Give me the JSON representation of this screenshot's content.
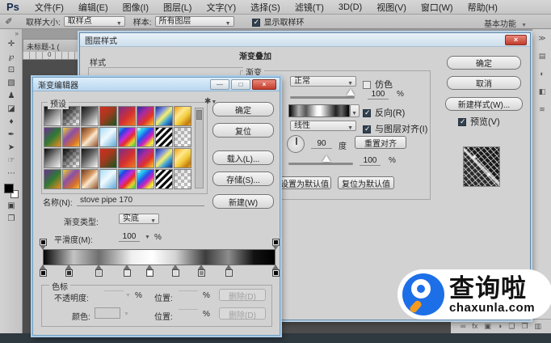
{
  "menu_bar": {
    "logo": "Ps",
    "items": [
      {
        "name": "file",
        "label": "文件(F)"
      },
      {
        "name": "edit",
        "label": "编辑(E)"
      },
      {
        "name": "image",
        "label": "图像(I)"
      },
      {
        "name": "layer",
        "label": "图层(L)"
      },
      {
        "name": "type",
        "label": "文字(Y)"
      },
      {
        "name": "select",
        "label": "选择(S)"
      },
      {
        "name": "filter",
        "label": "滤镜(T)"
      },
      {
        "name": "3d",
        "label": "3D(D)"
      },
      {
        "name": "view",
        "label": "视图(V)"
      },
      {
        "name": "window",
        "label": "窗口(W)"
      },
      {
        "name": "help",
        "label": "帮助(H)"
      }
    ]
  },
  "options_bar": {
    "tool_glyph": "✐",
    "sample_size_label": "取样大小:",
    "sample_size_value": "取样点",
    "sample_label": "样本:",
    "sample_value": "所有图层",
    "show_ring_label": "显示取样环",
    "workspace": "基本功能"
  },
  "document": {
    "tab": "未标题-1 (",
    "ruler_zero": "0"
  },
  "toolbar": {
    "collapse_glyph": "»",
    "tools": [
      {
        "name": "move-tool",
        "glyph": "✛"
      },
      {
        "name": "lasso-tool",
        "glyph": "℘"
      },
      {
        "name": "crop-tool",
        "glyph": "⊡"
      },
      {
        "name": "healing-brush-tool",
        "glyph": "▧"
      },
      {
        "name": "clone-stamp-tool",
        "glyph": "♟"
      },
      {
        "name": "eraser-tool",
        "glyph": "◪"
      },
      {
        "name": "blur-tool",
        "glyph": "♦"
      },
      {
        "name": "pen-tool",
        "glyph": "✒"
      },
      {
        "name": "path-selection-tool",
        "glyph": "➤"
      },
      {
        "name": "hand-tool",
        "glyph": "☞"
      },
      {
        "name": "more-tools",
        "glyph": "⋯"
      }
    ],
    "bottom_tools": [
      {
        "name": "quick-mask-icon",
        "glyph": "▣"
      },
      {
        "name": "screen-mode-icon",
        "glyph": "❐"
      }
    ]
  },
  "dock": {
    "icons": [
      {
        "name": "dock-collapse-icon",
        "glyph": "≫"
      },
      {
        "name": "dock-panel-icon-1",
        "glyph": "▤"
      },
      {
        "name": "dock-panel-icon-2",
        "glyph": "◐"
      },
      {
        "name": "dock-panel-icon-3",
        "glyph": "◧"
      },
      {
        "name": "dock-panel-icon-4",
        "glyph": "≋"
      }
    ]
  },
  "layers_panel": {
    "icons": [
      {
        "name": "link-layers-icon",
        "glyph": "∞"
      },
      {
        "name": "layer-effects-icon",
        "glyph": "fx"
      },
      {
        "name": "layer-mask-icon",
        "glyph": "▣"
      },
      {
        "name": "adjustment-layer-icon",
        "glyph": "◑"
      },
      {
        "name": "layer-group-icon",
        "glyph": "❏"
      },
      {
        "name": "new-layer-icon",
        "glyph": "❐"
      },
      {
        "name": "delete-layer-icon",
        "glyph": "▥"
      }
    ]
  },
  "layer_style_dialog": {
    "title": "图层样式",
    "close_glyph": "×",
    "styles_label": "样式",
    "section_title": "渐变叠加",
    "group_label": "渐变",
    "blend_mode_value": "正常",
    "dither_label": "仿色",
    "opacity_value": "100",
    "percent": "%",
    "reverse_label": "反向(R)",
    "style_value": "线性",
    "align_label": "与图层对齐(I)",
    "angle_value": "90",
    "degree_label": "度",
    "reset_align_label": "重置对齐",
    "scale_value": "100",
    "set_default_label": "设置为默认值",
    "reset_default_label": "复位为默认值",
    "ok_label": "确定",
    "cancel_label": "取消",
    "new_style_label": "新建样式(W)...",
    "preview_label": "预览(V)",
    "gradient_css": "linear-gradient(90deg,#000 0%,#b0b0b0 16%,#555 28%,#f8f8f8 46%,#fff 52%,#999 64%,#222 78%,#666 87%,#000 100%)"
  },
  "gradient_editor": {
    "title": "渐变编辑器",
    "window_buttons": [
      {
        "name": "minimize-button",
        "glyph": "—"
      },
      {
        "name": "maximize-button",
        "glyph": "□"
      },
      {
        "name": "close-button",
        "glyph": "×",
        "red": true
      }
    ],
    "presets_label": "预设",
    "gear_glyph": "✱",
    "ok_label": "确定",
    "reset_label": "复位",
    "load_label": "载入(L)...",
    "save_label": "存储(S)...",
    "new_label": "新建(W)",
    "name_label": "名称(N):",
    "name_value": "stove pipe 170",
    "type_label": "渐变类型:",
    "type_value": "实底",
    "smoothness_label": "平滑度(M):",
    "smoothness_value": "100",
    "percent": "%",
    "stops_label": "色标",
    "opacity_label": "不透明度:",
    "location_label": "位置:",
    "delete_label": "删除(D)",
    "color_label": "颜色:",
    "preset_rows_repeat": 2,
    "presets": [
      {
        "name": "foreground-to-background",
        "css": "linear-gradient(135deg,#050505 0%,#9a9a9a 55%,#f5f5f5 100%)"
      },
      {
        "name": "foreground-to-transparent",
        "css": "linear-gradient(135deg,#050505 0%,rgba(5,5,5,0) 95%)"
      },
      {
        "name": "black-white",
        "css": "linear-gradient(135deg,#161616 0%,#5e5e5e 40%,#fdfdfd 100%)"
      },
      {
        "name": "red-green",
        "css": "linear-gradient(135deg,#d62c22 0%,#a03a1e 45%,#14571f 100%)"
      },
      {
        "name": "violet-red-orange",
        "css": "linear-gradient(135deg,#7a2d8f 0%,#d6302f 55%,#ef7d1d 100%)"
      },
      {
        "name": "blue-red-yellow",
        "css": "linear-gradient(135deg,#2a2ea8 0%,#a82ba0 35%,#e03326 65%,#f2d22e 100%)"
      },
      {
        "name": "blue-yellow-blue",
        "css": "linear-gradient(135deg,#1d2f8f 0%,#7a8fe0 28%,#f6ef70 50%,#38a0d8 72%,#16267a 100%)"
      },
      {
        "name": "gold",
        "css": "linear-gradient(135deg,#f2990f 0%,#ffe98c 35%,#f2c93a 60%,#c27a0c 85%,#f2a818 100%)"
      },
      {
        "name": "violet-green-orange",
        "css": "linear-gradient(135deg,#6b2e8f 0%,#2e7a35 50%,#ef8c1a 100%)"
      },
      {
        "name": "yellow-violet-orange",
        "css": "linear-gradient(135deg,#f2d230 0%,#8a4fa8 40%,#d8702a 75%,#f2bd45 100%)"
      },
      {
        "name": "copper",
        "css": "linear-gradient(135deg,#6e3a1d 0%,#d89a66 40%,#fae8cf 55%,#8f4f26 100%)"
      },
      {
        "name": "pastel-blue",
        "css": "linear-gradient(135deg,#a8dcf5 0%,#f0faff 45%,#5ba6d8 100%)"
      },
      {
        "name": "spectrum",
        "css": "linear-gradient(135deg,#2bc8f0 0%,#2b3fe0 22%,#c02bd8 44%,#e82b2b 62%,#e8d02b 80%,#2bd058 100%)"
      },
      {
        "name": "rainbow-transparent",
        "css": "linear-gradient(135deg,rgba(255,255,255,0) 0%,#20c8f0 22%,#2b50e8 42%,#d020c0 62%,#f0e020 82%,rgba(255,255,255,0) 100%)"
      },
      {
        "name": "bw-stripes",
        "css": "repeating-linear-gradient(135deg,#0d0d0d 0px,#0d0d0d 3px,#f8f8f8 3px,#f8f8f8 6px)"
      },
      {
        "name": "transparent",
        "css": "linear-gradient(135deg,rgba(120,120,120,0.25) 0%,rgba(120,120,120,0) 100%)"
      }
    ],
    "bar_css": "linear-gradient(90deg,#050505 0%,#c4c4c4 13%,#6e6e6e 24%,#efefef 38%,#ffffff 47%,#d4d4d4 57%,#3d3d3d 70%,#8c8c8c 80%,#111 91%,#000 100%)",
    "opacity_stops": [
      {
        "pos": 0
      },
      {
        "pos": 100
      }
    ],
    "color_stops": [
      {
        "pos": 0,
        "color": "#0d0d0d"
      },
      {
        "pos": 11,
        "color": "#2e2e2e"
      },
      {
        "pos": 24,
        "color": "#cacaca"
      },
      {
        "pos": 36,
        "color": "#e6e6e6"
      },
      {
        "pos": 46,
        "color": "#ffffff"
      },
      {
        "pos": 57,
        "color": "#dcdcdc"
      },
      {
        "pos": 68,
        "color": "#8f8f8f"
      },
      {
        "pos": 80,
        "color": "#d0d0d0"
      },
      {
        "pos": 100,
        "color": "#050505"
      }
    ]
  },
  "watermark": {
    "name": "查询啦",
    "domain": "chaxunla.com"
  },
  "colors": {
    "titlebar_blue": "#cfe2f3",
    "close_red": "#c23b2a",
    "watermark_blue": "#1d6fe8",
    "watermark_orange": "#f59a1d",
    "canvas_dark": "#4d4d4d"
  }
}
